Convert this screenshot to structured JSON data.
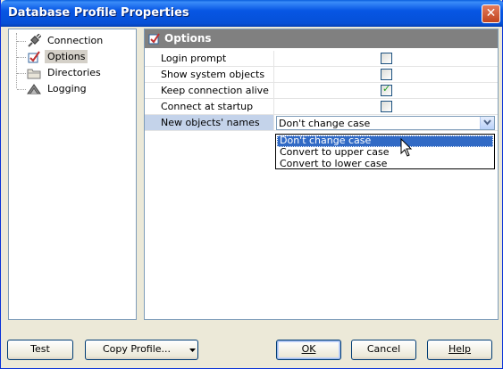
{
  "window": {
    "title": "Database Profile Properties"
  },
  "tree": {
    "items": [
      {
        "label": "Connection",
        "icon": "plug-icon"
      },
      {
        "label": "Options",
        "icon": "checkbox-icon",
        "selected": true
      },
      {
        "label": "Directories",
        "icon": "folder-icon"
      },
      {
        "label": "Logging",
        "icon": "log-icon"
      }
    ]
  },
  "panel": {
    "title": "Options",
    "properties": [
      {
        "name": "Login prompt",
        "checked": false
      },
      {
        "name": "Show system objects",
        "checked": false
      },
      {
        "name": "Keep connection alive",
        "checked": true
      },
      {
        "name": "Connect at startup",
        "checked": false
      }
    ],
    "combo_property": {
      "name": "New objects' names",
      "value": "Don't change case",
      "options": [
        "Don't change case",
        "Convert to upper case",
        "Convert to lower case"
      ],
      "selected_index": 0
    }
  },
  "buttons": {
    "test": "Test",
    "copy_profile": "Copy Profile...",
    "ok": "OK",
    "cancel": "Cancel",
    "help": "Help"
  },
  "colors": {
    "titlebar": "#0756e4",
    "selection": "#316ac5",
    "panel_header": "#808080"
  }
}
